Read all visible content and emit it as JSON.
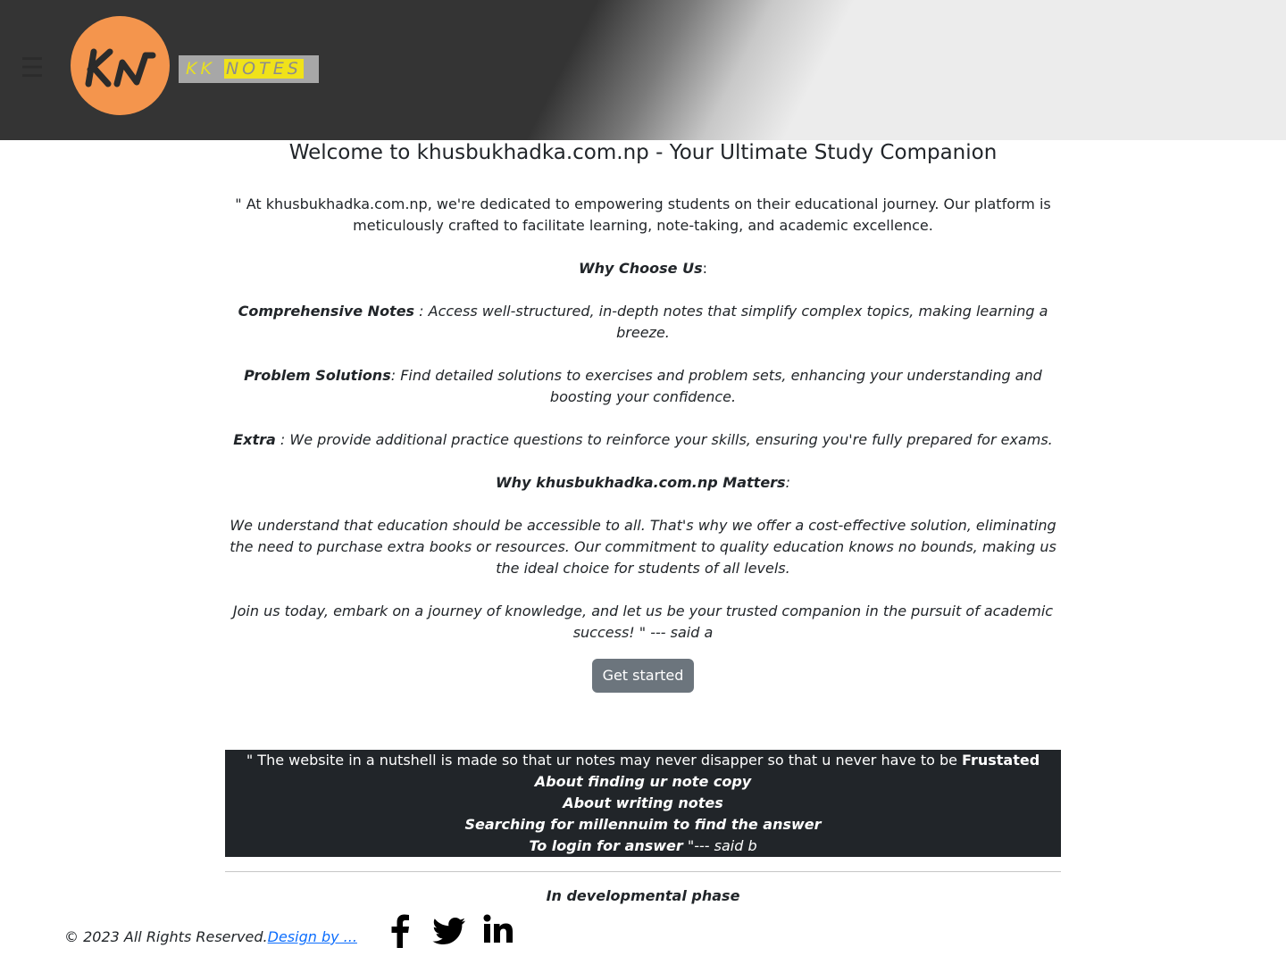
{
  "header": {
    "menu_icon": "☰",
    "logo_initials": "KN",
    "brand": {
      "part1": "KK ",
      "part2": "NOTES"
    },
    "colors": {
      "logo_circle": "#f4954d",
      "brand_highlight": "#f0e21a"
    }
  },
  "main": {
    "welcome": "Welcome to khusbukhadka.com.np - Your Ultimate Study Companion",
    "intro": "\" At khusbukhadka.com.np, we're dedicated to empowering students on their educational journey. Our platform is meticulously crafted to facilitate learning, note-taking, and academic excellence.",
    "why_choose": "Why Choose Us",
    "colon": ":",
    "comprehensive_title": "Comprehensive Notes",
    "comprehensive_text": " : Access well-structured, in-depth notes that simplify complex topics, making learning a breeze.",
    "problem_title": "Problem Solutions",
    "problem_text": ": Find detailed solutions to exercises and problem sets, enhancing your understanding and boosting your confidence.",
    "extra_title": "Extra",
    "extra_text": " : We provide additional practice questions to reinforce your skills, ensuring you're fully prepared for exams.",
    "matters_title": "Why khusbukhadka.com.np Matters",
    "matters_text": "We understand that education should be accessible to all. That's why we offer a cost-effective solution, eliminating the need to purchase extra books or resources. Our commitment to quality education knows no bounds, making us the ideal choice for students of all levels.",
    "join_text": "Join us today, embark on a journey of knowledge, and let us be your trusted companion in the pursuit of academic success! \" --- said a",
    "cta": "Get started"
  },
  "quote": {
    "lead": "\" The website in a nutshell is made so that ur notes may never disapper so that u never have to be ",
    "frustrated": "Frustated",
    "line2": "About finding ur note copy",
    "line3": "About writing notes",
    "line4": "Searching for millennuim to find the answer",
    "line5": "To login for answer",
    "tail": " \"--- said b"
  },
  "status": "In developmental phase",
  "footer": {
    "copyright": "© 2023 All Rights Reserved.",
    "design_link": "Design by ...",
    "social": [
      "facebook-icon",
      "twitter-icon",
      "linkedin-icon"
    ]
  }
}
